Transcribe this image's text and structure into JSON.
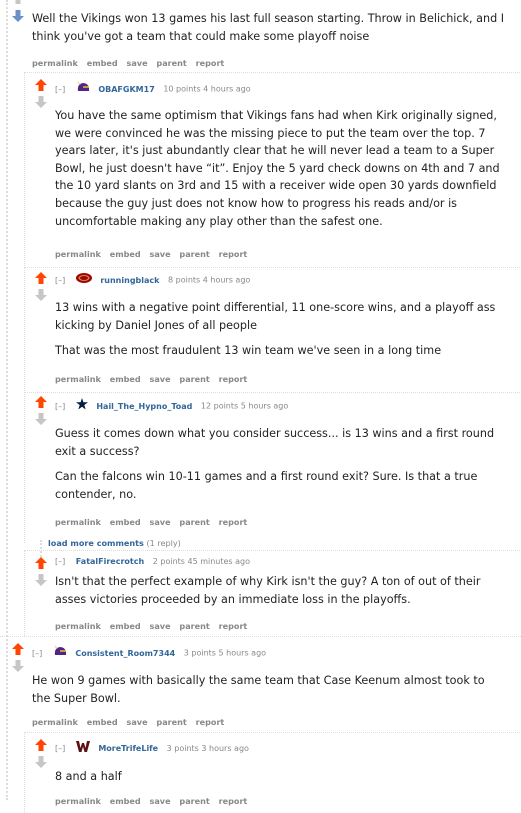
{
  "colors": {
    "upvote": "#ff4500",
    "downvote": "#6a8fc9",
    "neutral_arrow": "#c6c6c6",
    "author": "#336699",
    "meta": "#888888"
  },
  "top_fragment": {
    "text": "Well the Vikings won 13 games his last full season starting. Throw in Belichick, and I think you've got a team that could make some playoff noise",
    "links": [
      "permalink",
      "embed",
      "save",
      "parent",
      "report"
    ]
  },
  "comments": [
    {
      "collapse": "[–]",
      "flair": "vikings-helmet-icon",
      "author": "OBAFGKM17",
      "points": "10 points",
      "time": "4 hours ago",
      "paragraphs": [
        "You have the same optimism that Vikings fans had when Kirk originally signed, we were convinced he was the missing piece to put the team over the top. 7 years later, it's just abundantly clear that he will never lead a team to a Super Bowl, he just doesn't have “it”. Enjoy the 5 yard check downs on 4th and 7 and the 10 yard slants on 3rd and 15 with a receiver wide open 30 yards downfield because the guy just does not know how to progress his reads and/or is uncomfortable making any play other than the safest one."
      ],
      "links": [
        "permalink",
        "embed",
        "save",
        "parent",
        "report"
      ]
    },
    {
      "collapse": "[–]",
      "flair": "49ers-logo-icon",
      "author": "runningblack",
      "points": "8 points",
      "time": "4 hours ago",
      "paragraphs": [
        "13 wins with a negative point differential, 11 one-score wins, and a playoff ass kicking by Daniel Jones of all people",
        "That was the most fraudulent 13 win team we've seen in a long time"
      ],
      "links": [
        "permalink",
        "embed",
        "save",
        "parent",
        "report"
      ]
    },
    {
      "collapse": "[–]",
      "flair": "cowboys-star-icon",
      "author": "Hail_The_Hypno_Toad",
      "points": "12 points",
      "time": "5 hours ago",
      "paragraphs": [
        "Guess it comes down what you consider success... is 13 wins and a first round exit a success?",
        "Can the falcons win 10-11 games and a first round exit? Sure. Is that a true contender, no."
      ],
      "links": [
        "permalink",
        "embed",
        "save",
        "parent",
        "report"
      ]
    },
    {
      "collapse": "[–]",
      "flair": "",
      "author": "FatalFirecrotch",
      "points": "2 points",
      "time": "45 minutes ago",
      "paragraphs": [
        "Isn't that the perfect example of why Kirk isn't the guy? A ton of out of their asses victories proceeded by an immediate loss in the playoffs."
      ],
      "links": [
        "permalink",
        "embed",
        "save",
        "parent",
        "report"
      ]
    },
    {
      "collapse": "[–]",
      "flair": "vikings-helmet-icon",
      "author": "Consistent_Room7344",
      "points": "3 points",
      "time": "5 hours ago",
      "paragraphs": [
        "He won 9 games with basically the same team that Case Keenum almost took to the Super Bowl."
      ],
      "links": [
        "permalink",
        "embed",
        "save",
        "parent",
        "report"
      ]
    },
    {
      "collapse": "[–]",
      "flair": "commanders-w-icon",
      "author": "MoreTrifeLife",
      "points": "3 points",
      "time": "3 hours ago",
      "paragraphs": [
        "8 and a half"
      ],
      "links": [
        "permalink",
        "embed",
        "save",
        "parent",
        "report"
      ]
    }
  ],
  "load_more": {
    "label": "load more comments",
    "count": "(1 reply)"
  }
}
